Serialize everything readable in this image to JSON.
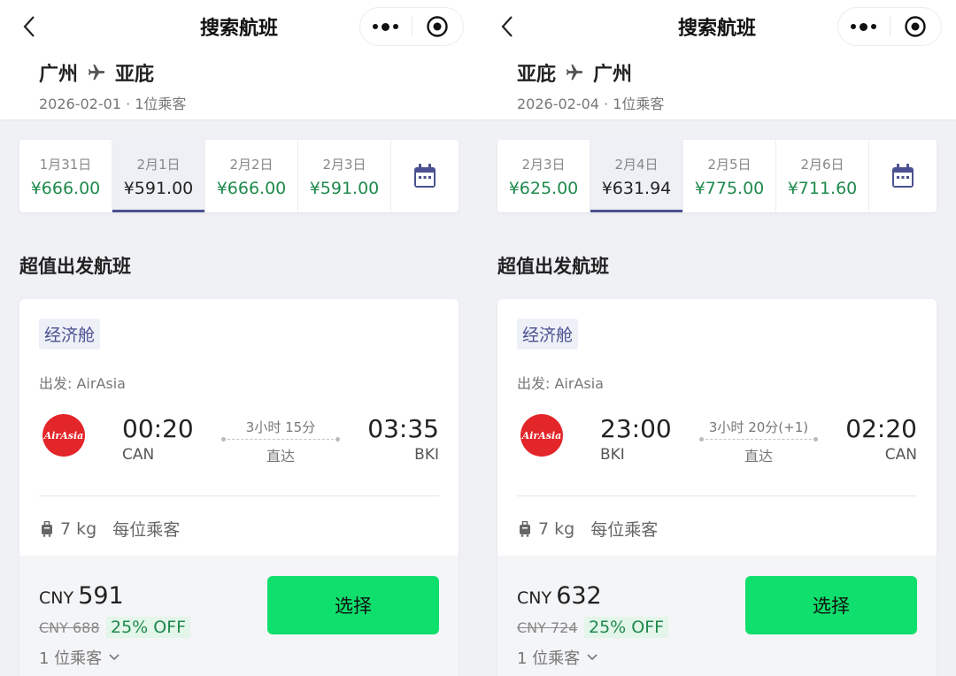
{
  "panels": [
    {
      "title": "搜索航班",
      "route": {
        "from": "广州",
        "to": "亚庇"
      },
      "subinfo": "2026-02-01 · 1位乘客",
      "dates": [
        {
          "date": "1月31日",
          "price": "¥666.00",
          "selected": false
        },
        {
          "date": "2月1日",
          "price": "¥591.00",
          "selected": true
        },
        {
          "date": "2月2日",
          "price": "¥666.00",
          "selected": false
        },
        {
          "date": "2月3日",
          "price": "¥591.00",
          "selected": false
        }
      ],
      "section_title": "超值出发航班",
      "card": {
        "cabin": "经济舱",
        "airline": "出发: AirAsia",
        "logo_text": "AirAsia",
        "dep_time": "00:20",
        "dep_code": "CAN",
        "duration": "3小时 15分",
        "stops": "直达",
        "arr_time": "03:35",
        "arr_code": "BKI",
        "baggage": "7 kg",
        "baggage_per": "每位乘客",
        "currency": "CNY",
        "price": "591",
        "original": "CNY 688",
        "discount": "25% OFF",
        "pax": "1 位乘客",
        "select_label": "选择"
      }
    },
    {
      "title": "搜索航班",
      "route": {
        "from": "亚庇",
        "to": "广州"
      },
      "subinfo": "2026-02-04 · 1位乘客",
      "dates": [
        {
          "date": "2月3日",
          "price": "¥625.00",
          "selected": false
        },
        {
          "date": "2月4日",
          "price": "¥631.94",
          "selected": true
        },
        {
          "date": "2月5日",
          "price": "¥775.00",
          "selected": false
        },
        {
          "date": "2月6日",
          "price": "¥711.60",
          "selected": false
        }
      ],
      "section_title": "超值出发航班",
      "card": {
        "cabin": "经济舱",
        "airline": "出发: AirAsia",
        "logo_text": "AirAsia",
        "dep_time": "23:00",
        "dep_code": "BKI",
        "duration": "3小时 20分(+1)",
        "stops": "直达",
        "arr_time": "02:20",
        "arr_code": "CAN",
        "baggage": "7 kg",
        "baggage_per": "每位乘客",
        "currency": "CNY",
        "price": "632",
        "original": "CNY 724",
        "discount": "25% OFF",
        "pax": "1 位乘客",
        "select_label": "选择"
      }
    }
  ],
  "colors": {
    "accent": "#4a5190",
    "price_green": "#1f8a4d",
    "button_green": "#0fdf6c",
    "logo_red": "#e3262a"
  }
}
